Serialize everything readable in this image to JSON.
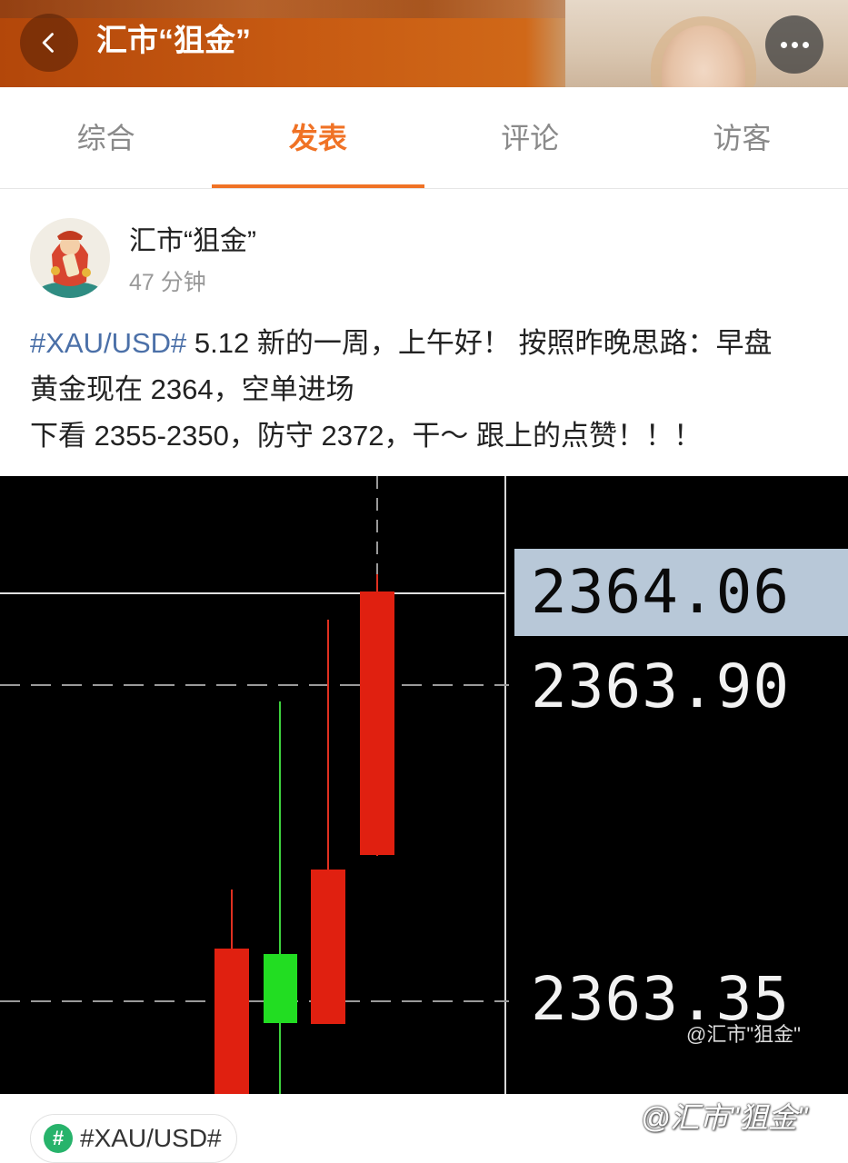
{
  "header": {
    "title": "汇市“狙金”",
    "back_icon": "chevron-left-icon",
    "more_icon": "more-dots-icon"
  },
  "tabs": [
    {
      "label": "综合",
      "active": false
    },
    {
      "label": "发表",
      "active": true
    },
    {
      "label": "评论",
      "active": false
    },
    {
      "label": "访客",
      "active": false
    }
  ],
  "post": {
    "user_name": "汇市“狙金”",
    "time": "47 分钟",
    "hashtag": "#XAU/USD#",
    "line1_rest": " 5.12 新的一周，上午好！ 按照昨晚思路：早盘",
    "line2": "黄金现在 2364，空单进场",
    "line3": "下看 2355-2350，防守 2372，干～ 跟上的点赞！！！"
  },
  "chart": {
    "current_price": "2364.06",
    "level_upper": "2363.90",
    "level_lower": "2363.35",
    "watermark": "@汇市\"狙金\""
  },
  "topic": {
    "icon": "hash-icon",
    "label": "#XAU/USD#"
  },
  "watermark": "@汇市\"狙金\"",
  "colors": {
    "accent": "#f07225",
    "hashtag": "#4b70a8",
    "candle_red": "#e02010",
    "candle_green": "#22dd22",
    "topic_green": "#27b36b"
  }
}
